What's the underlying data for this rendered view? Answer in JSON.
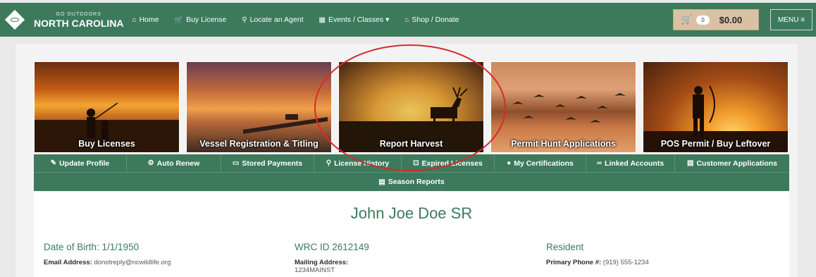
{
  "header": {
    "logo_small": "GO OUTDOORS",
    "logo_big": "NORTH CAROLINA",
    "nav": [
      {
        "icon": "home-icon",
        "glyph": "⌂",
        "label": "Home"
      },
      {
        "icon": "cart-icon",
        "glyph": "🛒",
        "label": "Buy License"
      },
      {
        "icon": "map-pin-icon",
        "glyph": "⚲",
        "label": "Locate an Agent"
      },
      {
        "icon": "calendar-icon",
        "glyph": "▦",
        "label": "Events / Classes ▾"
      },
      {
        "icon": "store-icon",
        "glyph": "⌂",
        "label": "Shop / Donate"
      }
    ],
    "cart_count": "0",
    "cart_total": "$0.00",
    "menu_label": "MENU ≡"
  },
  "tiles": [
    {
      "label": "Buy Licenses"
    },
    {
      "label": "Vessel Registration & Titling"
    },
    {
      "label": "Report Harvest"
    },
    {
      "label": "Permit Hunt Applications"
    },
    {
      "label": "POS Permit / Buy Leftover"
    }
  ],
  "subnav": {
    "row1": [
      {
        "icon": "edit-icon",
        "glyph": "✎",
        "label": "Update Profile"
      },
      {
        "icon": "gear-icon",
        "glyph": "⚙",
        "label": "Auto Renew"
      },
      {
        "icon": "credit-card-icon",
        "glyph": "▭",
        "label": "Stored Payments"
      },
      {
        "icon": "search-icon",
        "glyph": "⚲",
        "label": "License History"
      },
      {
        "icon": "expired-icon",
        "glyph": "⊡",
        "label": "Expired Licenses"
      },
      {
        "icon": "certificate-icon",
        "glyph": "●",
        "label": "My Certifications"
      },
      {
        "icon": "link-icon",
        "glyph": "∞",
        "label": "Linked Accounts"
      },
      {
        "icon": "document-icon",
        "glyph": "▤",
        "label": "Customer Applications"
      }
    ],
    "row2": {
      "icon": "file-icon",
      "glyph": "▤",
      "label": "Season Reports"
    }
  },
  "profile": {
    "name": "John Joe Doe SR",
    "dob": "Date of Birth: 1/1/1950",
    "email_label": "Email Address:",
    "email_value": "donotreply@ncwildlife.org",
    "wrc_id": "WRC ID 2612149",
    "mailing_label": "Mailing Address:",
    "mailing_value": "1234MAINST",
    "residency": "Resident",
    "phone_label": "Primary Phone #:",
    "phone_value": "(919) 555-1234"
  },
  "colors": {
    "brand_green": "#3d7a5c",
    "cart_tan": "#d9c2a4",
    "annotation_red": "#d42b2b"
  }
}
